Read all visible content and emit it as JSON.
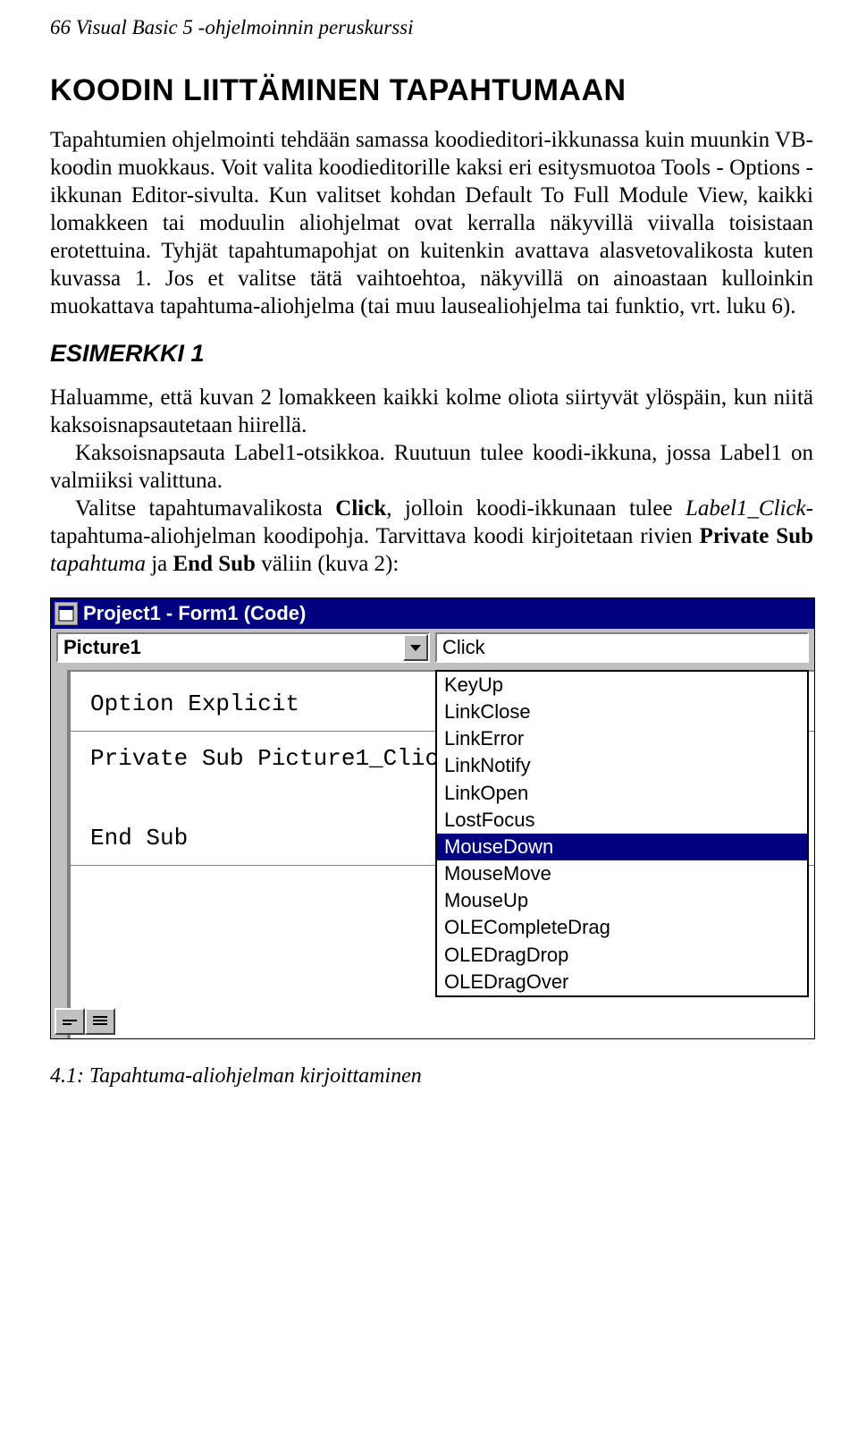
{
  "header": "66 Visual Basic 5 -ohjelmoinnin peruskurssi",
  "heading1": "KOODIN LIITTÄMINEN TAPAHTUMAAN",
  "para1": "Tapahtumien ohjelmointi tehdään samassa koodieditori-ikkunassa kuin muunkin VB-koodin muokkaus. Voit valita koodieditorille kaksi eri esitysmuotoa Tools - Options -ikkunan Editor-sivulta. Kun valitset kohdan Default To Full Module View, kaikki lomakkeen tai moduulin aliohjelmat ovat kerralla näkyvillä viivalla toisistaan erotettuina. Tyhjät tapahtumapohjat on kuitenkin avattava alasvetovalikosta kuten kuvassa 1. Jos et valitse tätä vaihtoehtoa, näkyvillä on ainoastaan kulloinkin muokattava tapahtuma-aliohjelma (tai muu lausealiohjelma tai funktio, vrt. luku 6).",
  "heading2": "ESIMERKKI 1",
  "para2a": "Haluamme, että kuvan 2 lomakkeen kaikki kolme oliota siirtyvät ylöspäin, kun niitä kaksoisnapsautetaan hiirellä.",
  "para2b": "Kaksoisnapsauta Label1-otsikkoa. Ruutuun tulee koodi-ikkuna, jossa Label1 on valmiiksi valittuna.",
  "para2c_1": "Valitse tapahtumavalikosta ",
  "para2c_bold1": "Click",
  "para2c_2": ", jolloin koodi-ikkunaan tulee ",
  "para2c_ital": "Label1_Click",
  "para2c_3": "-tapahtuma-aliohjelman koodipohja. Tarvittava koodi kirjoitetaan rivien ",
  "para2c_bold2": "Private Sub",
  "para2c_4": " ",
  "para2c_ital2": "tapahtuma",
  "para2c_5": " ja ",
  "para2c_bold3": "End Sub",
  "para2c_6": " väliin (kuva 2):",
  "screenshot": {
    "title": "Project1 - Form1 (Code)",
    "object_combo": "Picture1",
    "proc_combo": "Click",
    "code_line1": "Option Explicit",
    "code_line2": "Private Sub Picture1_Clic",
    "code_line3": "End Sub",
    "events": [
      "KeyUp",
      "LinkClose",
      "LinkError",
      "LinkNotify",
      "LinkOpen",
      "LostFocus",
      "MouseDown",
      "MouseMove",
      "MouseUp",
      "OLECompleteDrag",
      "OLEDragDrop",
      "OLEDragOver"
    ],
    "selected_event": "MouseDown"
  },
  "caption": "4.1: Tapahtuma-aliohjelman kirjoittaminen"
}
